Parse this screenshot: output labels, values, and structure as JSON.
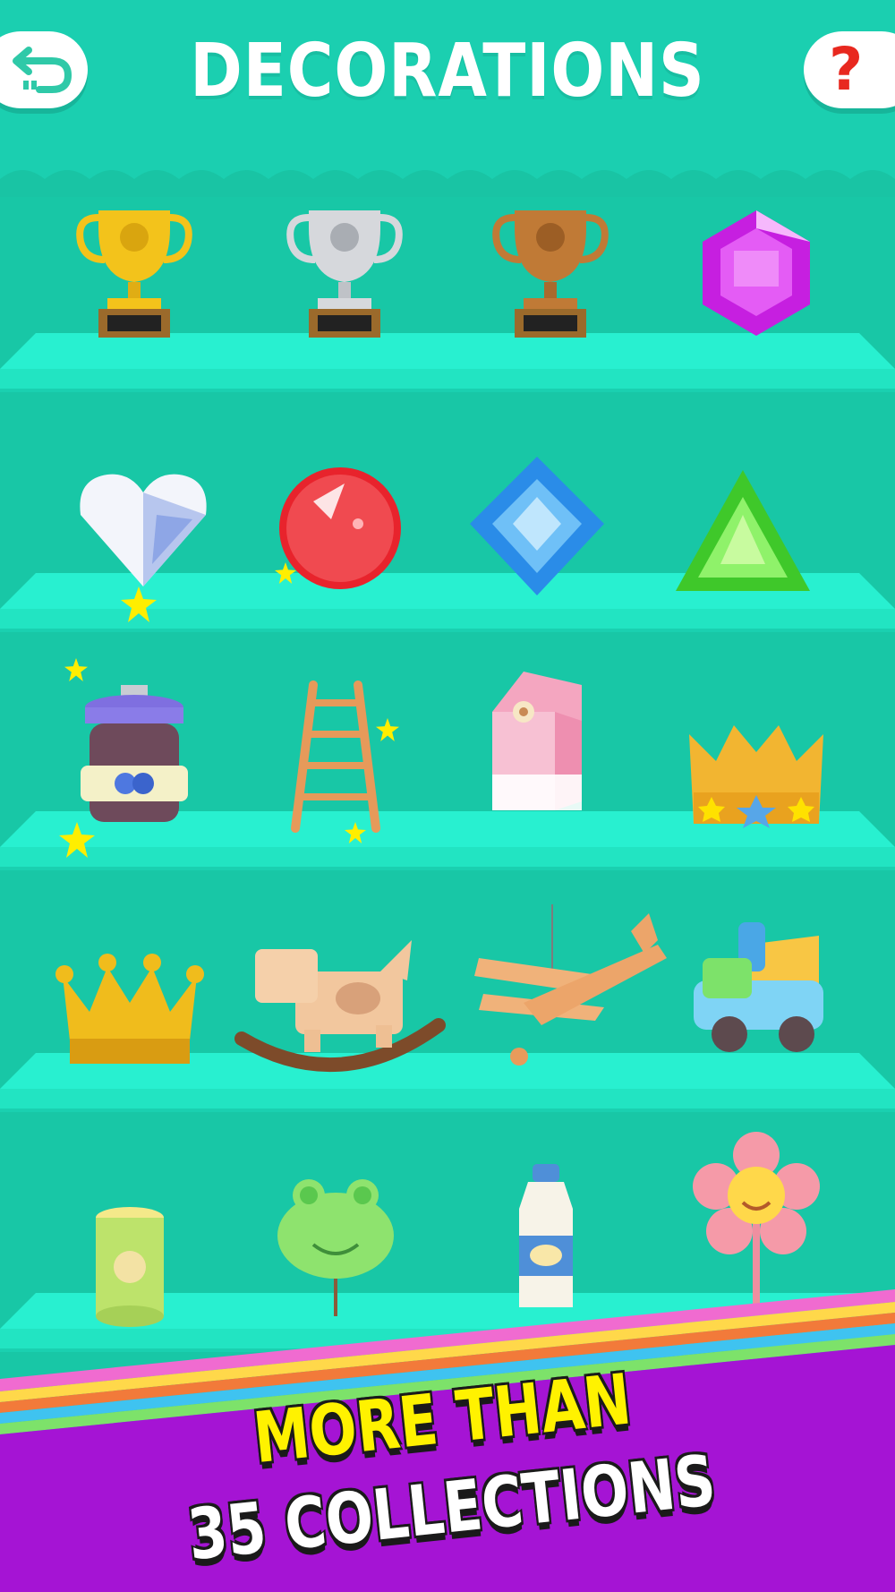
{
  "header": {
    "title": "DECORATIONS",
    "back_icon": "back-arrow-icon",
    "help_label": "?"
  },
  "colors": {
    "background": "#18c7a6",
    "shelf": "#28f0d0",
    "banner_purple": "#a514d4",
    "banner_line1": "#fff200",
    "help_red": "#e8281f"
  },
  "collection": {
    "rows": [
      [
        "gold-trophy",
        "silver-trophy",
        "bronze-trophy",
        "purple-gem"
      ],
      [
        "crystal-heart",
        "red-orb",
        "blue-diamond-gem",
        "green-triangle-gem"
      ],
      [
        "blueberry-jam-jar",
        "wooden-ladder",
        "milk-carton",
        "jeweled-crown"
      ],
      [
        "gold-crown",
        "rocking-dog-toy",
        "toy-biplane",
        "toy-dump-truck"
      ],
      [
        "baby-food-can",
        "frog-tree-sign",
        "milk-bottle",
        "smiling-flower"
      ]
    ]
  },
  "banner": {
    "line1": "MORE THAN",
    "line2": "35 COLLECTIONS"
  }
}
